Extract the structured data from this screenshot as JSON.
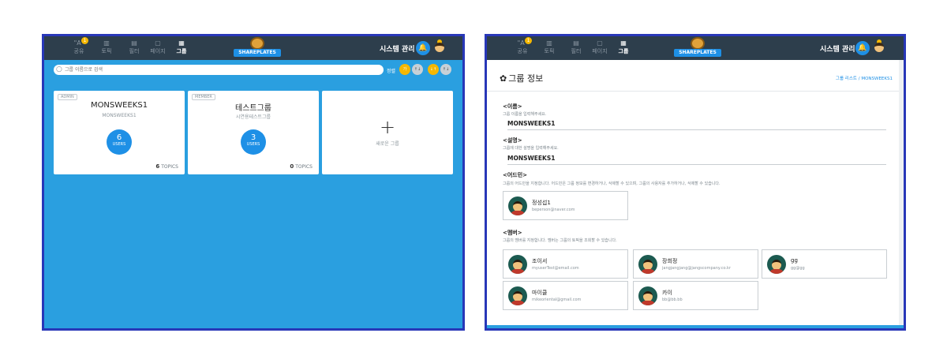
{
  "left": {
    "nav": {
      "share": "공유",
      "share_badge": "1",
      "topic": "토픽",
      "filter": "필터",
      "page": "페이지",
      "group": "그룹",
      "brand": "SHAREPLATES",
      "sysadmin": "시스템 관리"
    },
    "search": {
      "placeholder": "그룹 이름으로 검색"
    },
    "sort": {
      "label": "정렬",
      "buttons": [
        "가",
        "↑↓",
        "↓↑",
        "↑↓"
      ]
    },
    "cards": [
      {
        "role": "ADMIN",
        "name": "MONSWEEKS1",
        "desc": "MONSWEEKS1",
        "users": "6",
        "users_label": "USERS",
        "topics_count": "6",
        "topics_label": "TOPICS"
      },
      {
        "role": "MEMBER",
        "name": "테스트그룹",
        "desc": "시연용테스트그룹",
        "users": "3",
        "users_label": "USERS",
        "topics_count": "0",
        "topics_label": "TOPICS"
      }
    ],
    "new_group": {
      "plus": "+",
      "label": "새로운 그룹"
    }
  },
  "right": {
    "nav": {
      "share": "공유",
      "share_badge": "1",
      "topic": "토픽",
      "filter": "필터",
      "page": "페이지",
      "group": "그룹",
      "brand": "SHAREPLATES",
      "sysadmin": "시스템 관리"
    },
    "title": "그룹 정보",
    "breadcrumb": "그룹 리스트 / MONSWEEKS1",
    "name_label": "<이름>",
    "name_help": "그룹 이름을 입력해주세요.",
    "name_value": "MONSWEEKS1",
    "desc_label": "<설명>",
    "desc_help": "그룹에 대한 설명을 입력해주세요.",
    "desc_value": "MONSWEEKS1",
    "admin_label": "<어드민>",
    "admin_help": "그룹의 어드민을 지정합니다. 어드민은 그룹 정보를 변경하거나, 삭제할 수 있으며, 그룹의 사용자를 추가하거나, 삭제할 수 있습니다.",
    "admins": [
      {
        "name": "정성섭1",
        "email": "beperson@naver.com"
      }
    ],
    "member_label": "<멤버>",
    "member_help": "그룹의 멤버를 지정합니다. 멤버는 그룹의 토픽을 조회할 수 있습니다.",
    "members": [
      {
        "name": "조이서",
        "email": "myuserTest@email.com"
      },
      {
        "name": "장희정",
        "email": "jangjangjang@jangscompany.co.kr"
      },
      {
        "name": "gg",
        "email": "gg@gg"
      },
      {
        "name": "마이클",
        "email": "mikeoriental@gmail.com"
      },
      {
        "name": "카이",
        "email": "bb@bb.bb"
      }
    ]
  }
}
